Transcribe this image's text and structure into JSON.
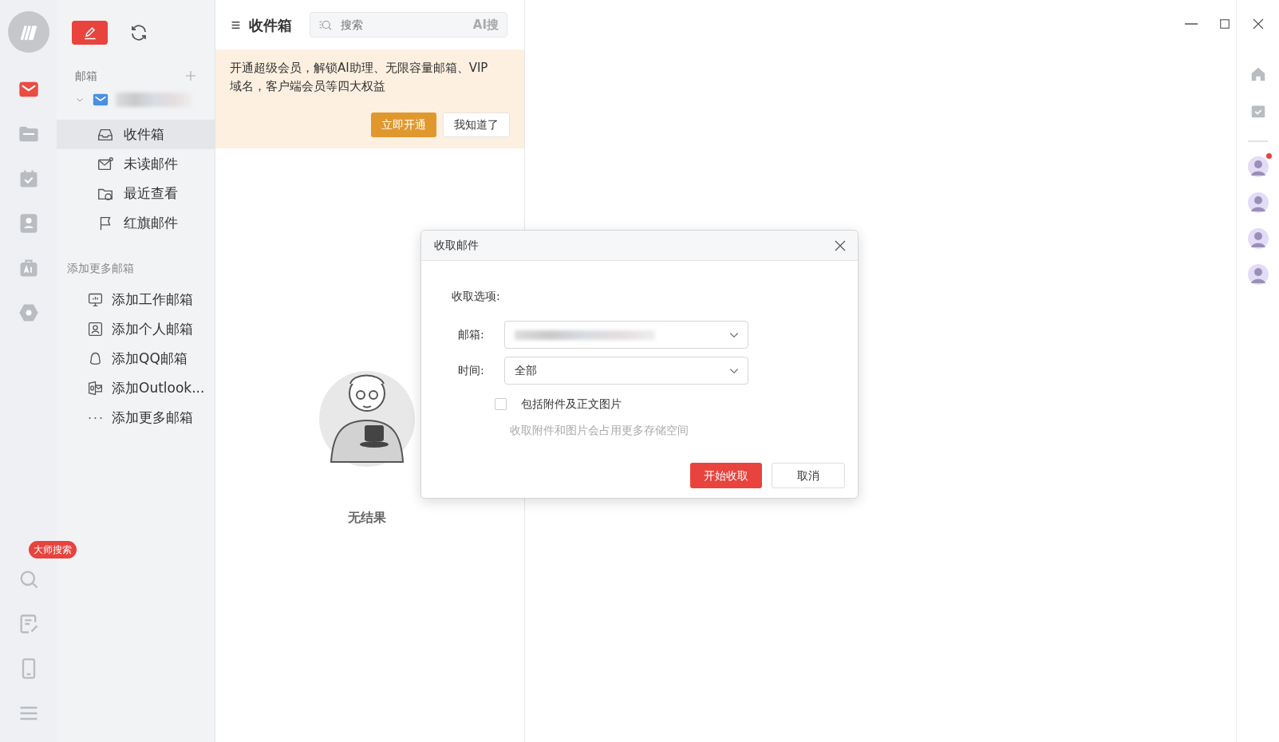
{
  "rail": {
    "items": [
      {
        "kind": "mail",
        "selected": true
      },
      {
        "kind": "folder",
        "selected": false
      },
      {
        "kind": "calendar",
        "selected": false
      },
      {
        "kind": "contacts",
        "selected": false
      },
      {
        "kind": "ai",
        "selected": false
      },
      {
        "kind": "settings",
        "selected": false
      }
    ],
    "bottom": [
      {
        "kind": "search",
        "badge": "大师搜索"
      },
      {
        "kind": "notes"
      },
      {
        "kind": "phone"
      },
      {
        "kind": "menu"
      }
    ]
  },
  "folders": {
    "header": "邮箱",
    "account": {
      "expanded": true
    },
    "items": [
      {
        "kind": "inbox",
        "label": "收件箱",
        "selected": true
      },
      {
        "kind": "unread",
        "label": "未读邮件",
        "selected": false
      },
      {
        "kind": "recent",
        "label": "最近查看",
        "selected": false
      },
      {
        "kind": "flag",
        "label": "红旗邮件",
        "selected": false
      }
    ],
    "add_header": "添加更多邮箱",
    "add_items": [
      {
        "kind": "work",
        "label": "添加工作邮箱"
      },
      {
        "kind": "personal",
        "label": "添加个人邮箱"
      },
      {
        "kind": "qq",
        "label": "添加QQ邮箱"
      },
      {
        "kind": "outlook",
        "label": "添加Outlook..."
      },
      {
        "kind": "more",
        "label": "添加更多邮箱"
      }
    ]
  },
  "list": {
    "title": "收件箱",
    "search": {
      "placeholder": "搜索",
      "ai_label": "AI搜"
    },
    "promo": {
      "text": "开通超级会员，解锁AI助理、无限容量邮箱、VIP域名，客户端会员等四大权益",
      "buttons": [
        {
          "label": "立即开通",
          "kind": "primary"
        },
        {
          "label": "我知道了",
          "kind": "secondary"
        }
      ]
    },
    "empty": "无结果"
  },
  "dialog": {
    "title": "收取邮件",
    "section": "收取选项:",
    "fields": [
      {
        "label": "邮箱:",
        "kind": "blurred"
      },
      {
        "label": "时间:",
        "kind": "text",
        "value": "全部"
      }
    ],
    "checkbox": {
      "label": "包括附件及正文图片",
      "checked": false
    },
    "hint": "收取附件和图片会占用更多存储空间",
    "buttons": [
      {
        "label": "开始收取",
        "kind": "primary"
      },
      {
        "label": "取消",
        "kind": "secondary"
      }
    ]
  },
  "right_rail": {
    "items": [
      {
        "kind": "home"
      },
      {
        "kind": "calendar"
      }
    ],
    "avatars": [
      {
        "unread": true
      },
      {
        "unread": false
      },
      {
        "unread": false
      },
      {
        "unread": false
      }
    ]
  }
}
